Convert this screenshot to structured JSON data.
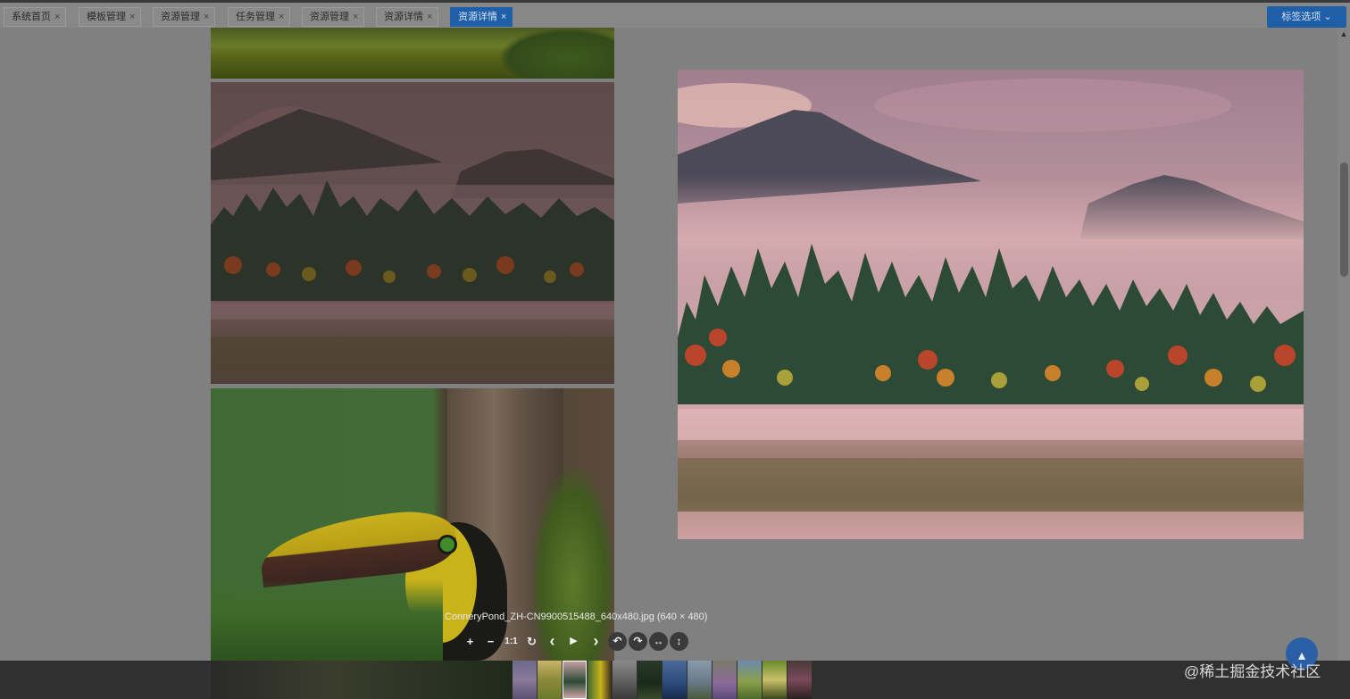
{
  "tabs": [
    {
      "label": "系统首页",
      "close": "×"
    },
    {
      "label": "模板管理",
      "close": "×"
    },
    {
      "label": "资源管理",
      "close": "×"
    },
    {
      "label": "任务管理",
      "close": "×"
    },
    {
      "label": "资源管理",
      "close": "×"
    },
    {
      "label": "资源详情",
      "close": "×"
    },
    {
      "label": "资源详情",
      "close": "×",
      "active": true
    }
  ],
  "tab_options": {
    "label": "标签选项",
    "icon": "chevron-down-icon"
  },
  "viewer": {
    "caption": "ConneryPond_ZH-CN9900515488_640x480.jpg (640 × 480)",
    "toolbar": {
      "zoom_in": "+",
      "zoom_out": "−",
      "one_to_one": "1:1",
      "reset": "↻",
      "prev": "‹",
      "play": "▶",
      "next": "›",
      "rotate_left": "↶",
      "rotate_right": "↷",
      "flip_horizontal": "↔",
      "flip_vertical": "↕"
    }
  },
  "back_to_top": "▲",
  "watermark": "@稀土掘金技术社区",
  "colors": {
    "accent": "#1e5fa8",
    "overlay": "#808080",
    "strip": "#303030"
  }
}
